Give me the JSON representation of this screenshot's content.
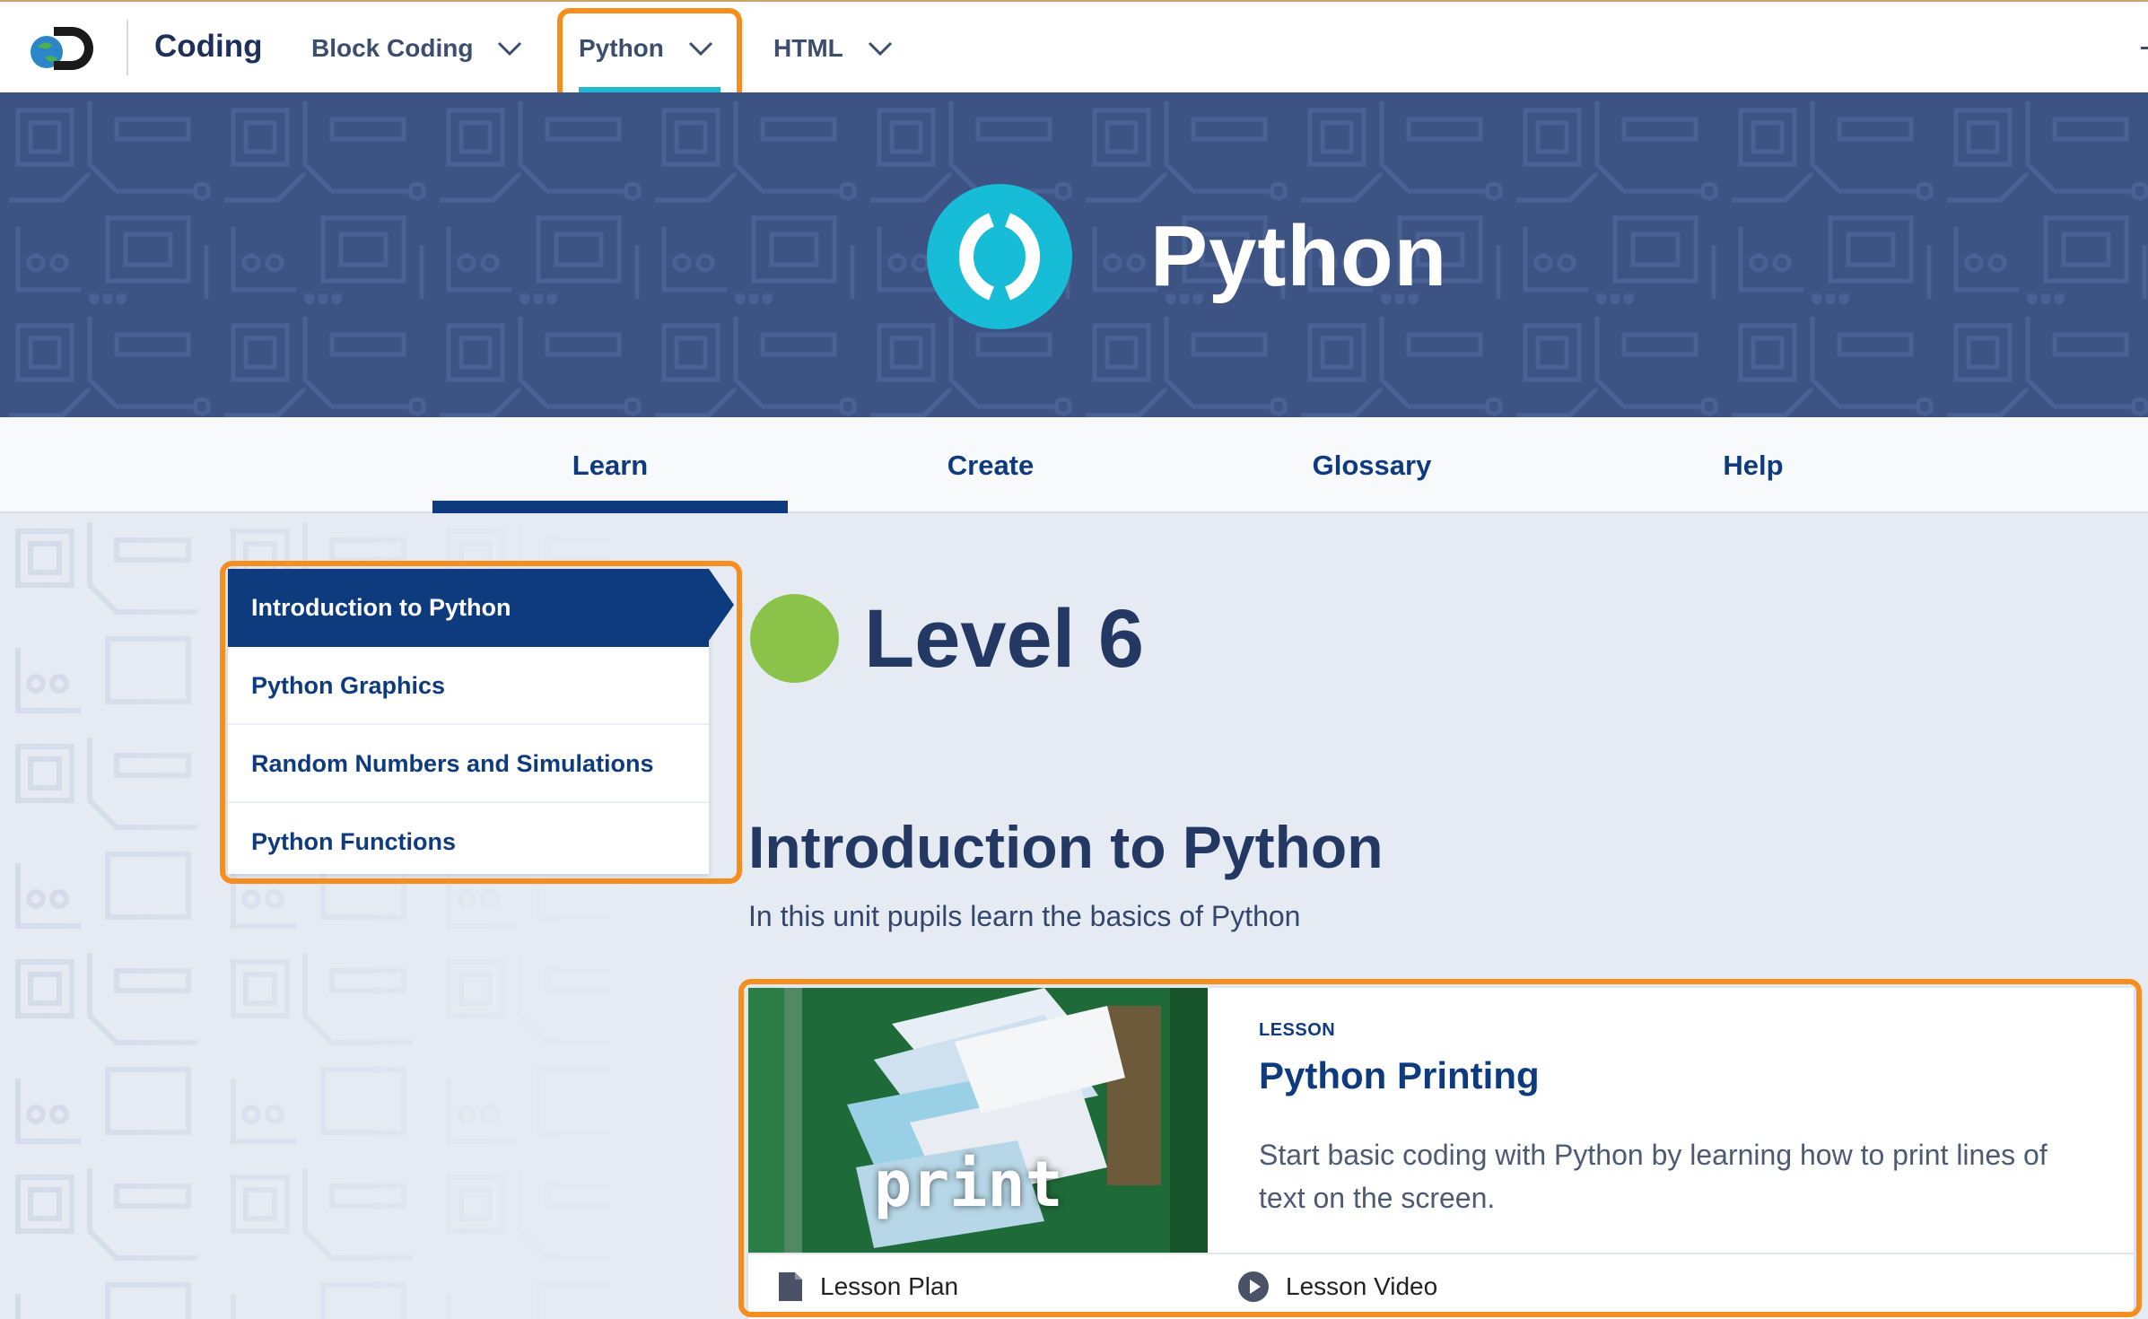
{
  "topnav": {
    "brand": "Coding",
    "items": [
      {
        "label": "Block Coding"
      },
      {
        "label": "Python"
      },
      {
        "label": "HTML"
      }
    ]
  },
  "hero": {
    "title": "Python",
    "icon": "parentheses-icon"
  },
  "tabs": [
    {
      "label": "Learn",
      "active": true
    },
    {
      "label": "Create"
    },
    {
      "label": "Glossary"
    },
    {
      "label": "Help"
    }
  ],
  "sidebar": {
    "items": [
      {
        "label": "Introduction to Python",
        "active": true
      },
      {
        "label": "Python Graphics"
      },
      {
        "label": "Random Numbers and Simulations"
      },
      {
        "label": "Python Functions"
      }
    ]
  },
  "main": {
    "level": "Level 6",
    "unit_title": "Introduction to Python",
    "unit_desc": "In this unit pupils learn the basics of Python",
    "card": {
      "kicker": "LESSON",
      "title": "Python Printing",
      "desc": "Start basic coding with Python by learning how to print lines of text on the screen.",
      "thumb_word": "print",
      "links": [
        {
          "label": "Lesson Plan",
          "icon": "document-icon"
        },
        {
          "label": "Lesson Video",
          "icon": "play-icon"
        }
      ]
    }
  },
  "colors": {
    "accent_highlight": "#f58e1f",
    "navy": "#0e3a7e",
    "cyan": "#17bdd7",
    "level_green": "#8bc34a",
    "hero_bg": "#3c5384"
  }
}
